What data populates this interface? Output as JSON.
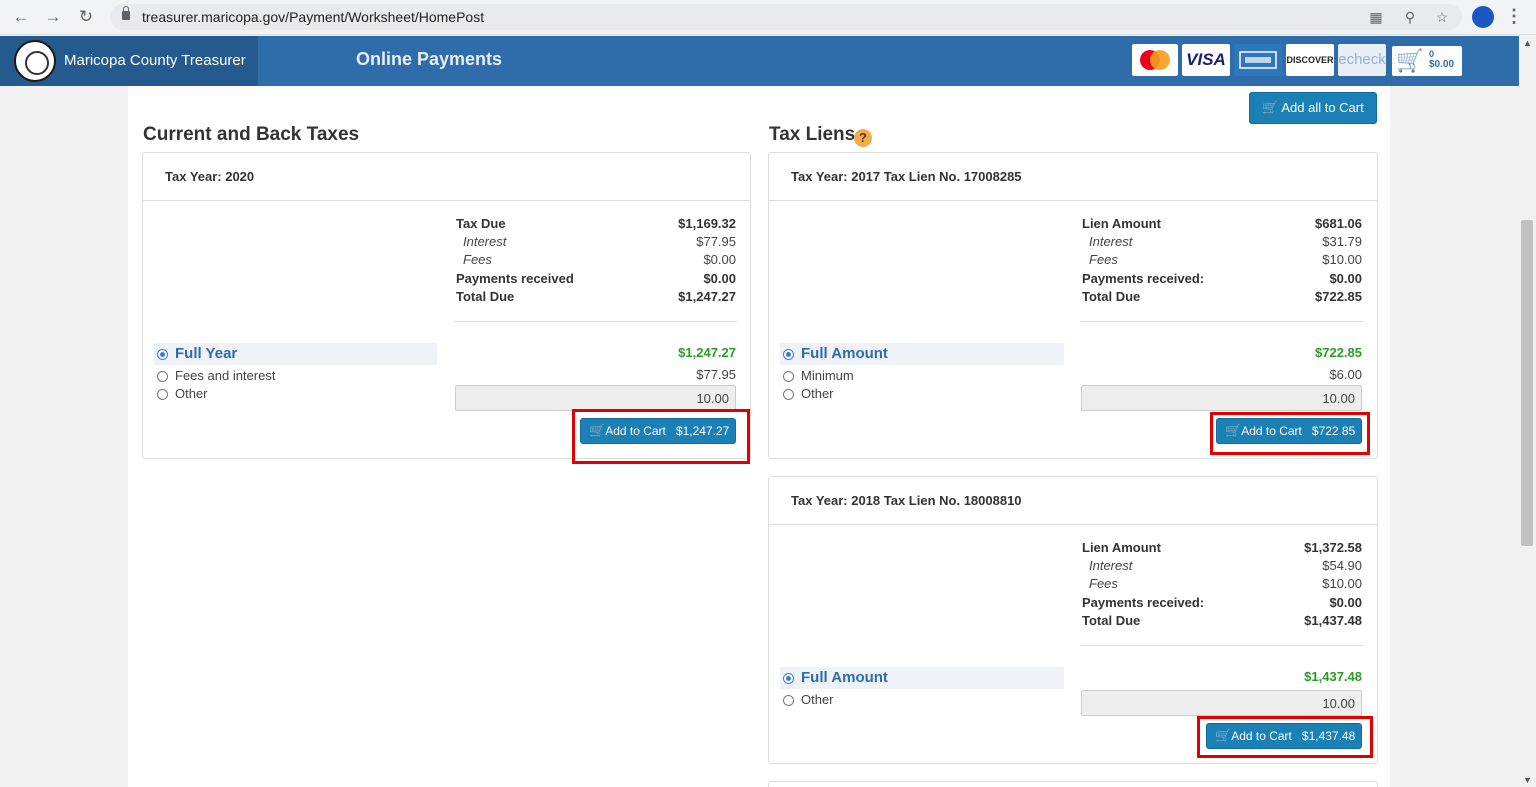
{
  "browser": {
    "url": "treasurer.maricopa.gov/Payment/Worksheet/HomePost"
  },
  "header": {
    "brand": "Maricopa County Treasurer",
    "title": "Online Payments",
    "cards": [
      "VISA",
      "DISCOVER",
      "echeck"
    ],
    "cart_count": "0",
    "cart_total": "$0.00"
  },
  "current": {
    "section_title": "Current and Back Taxes",
    "panel": {
      "heading": "Tax Year: 2020",
      "lines": [
        {
          "label": "Tax Due",
          "value": "$1,169.32"
        },
        {
          "label": "Interest",
          "value": "$77.95"
        },
        {
          "label": "Fees",
          "value": "$0.00"
        },
        {
          "label": "Payments received",
          "value": "$0.00"
        },
        {
          "label": "Total Due",
          "value": "$1,247.27"
        }
      ],
      "options": [
        {
          "label": "Full Year",
          "value": "$1,247.27"
        },
        {
          "label": "Fees and interest",
          "value": "$77.95"
        },
        {
          "label": "Other",
          "value": "10.00"
        }
      ],
      "button_label": "Add to Cart",
      "button_amount": "$1,247.27"
    }
  },
  "liens": {
    "section_title": "Tax Liens",
    "help": "?",
    "add_all_label": "Add all to Cart",
    "panels": [
      {
        "heading": "Tax Year: 2017  Tax Lien No.  17008285",
        "lines": [
          {
            "label": "Lien Amount",
            "value": "$681.06"
          },
          {
            "label": "Interest",
            "value": "$31.79"
          },
          {
            "label": "Fees",
            "value": "$10.00"
          },
          {
            "label": "Payments received:",
            "value": "$0.00"
          },
          {
            "label": "Total Due",
            "value": "$722.85"
          }
        ],
        "options": [
          {
            "label": "Full Amount",
            "value": "$722.85"
          },
          {
            "label": "Minimum",
            "value": "$6.00"
          },
          {
            "label": "Other",
            "value": "10.00"
          }
        ],
        "button_label": "Add to Cart",
        "button_amount": "$722.85"
      },
      {
        "heading": "Tax Year: 2018  Tax Lien No.  18008810",
        "lines": [
          {
            "label": "Lien Amount",
            "value": "$1,372.58"
          },
          {
            "label": "Interest",
            "value": "$54.90"
          },
          {
            "label": "Fees",
            "value": "$10.00"
          },
          {
            "label": "Payments received:",
            "value": "$0.00"
          },
          {
            "label": "Total Due",
            "value": "$1,437.48"
          }
        ],
        "options": [
          {
            "label": "Full Amount",
            "value": "$1,437.48"
          },
          {
            "label": "Other",
            "value": "10.00"
          }
        ],
        "button_label": "Add to Cart",
        "button_amount": "$1,437.48"
      }
    ]
  }
}
